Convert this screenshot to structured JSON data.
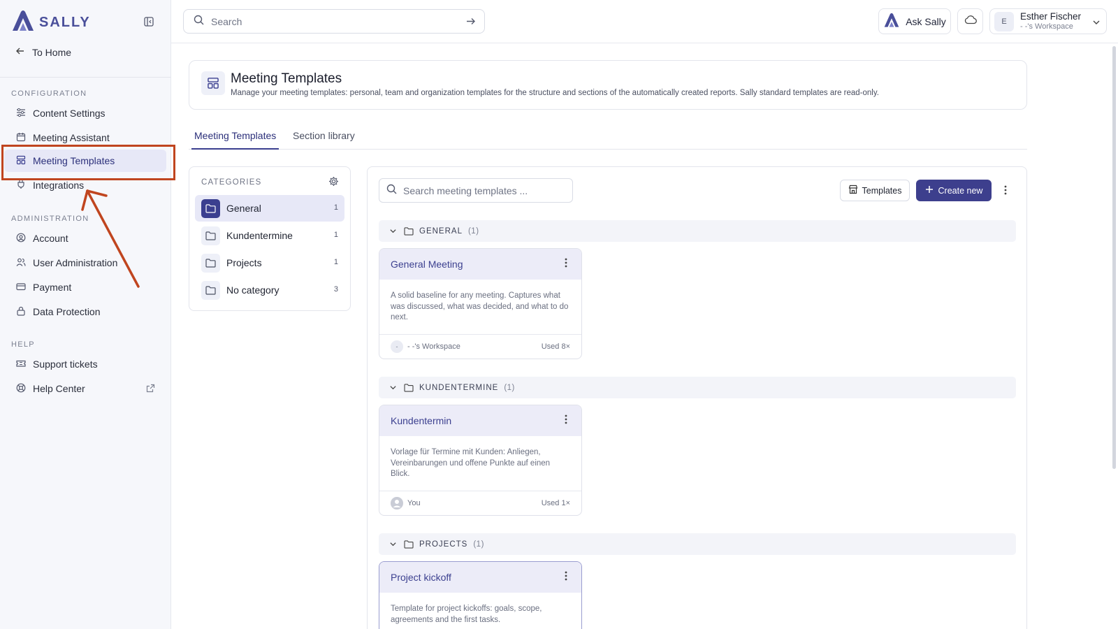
{
  "sidebar": {
    "brand": "SALLY",
    "to_home": "To Home",
    "sections": {
      "configuration": "CONFIGURATION",
      "administration": "ADMINISTRATION",
      "help": "HELP"
    },
    "items": {
      "content_settings": "Content Settings",
      "meeting_assistant": "Meeting Assistant",
      "meeting_templates": "Meeting Templates",
      "integrations": "Integrations",
      "account": "Account",
      "user_administration": "User Administration",
      "payment": "Payment",
      "data_protection": "Data Protection",
      "support_tickets": "Support tickets",
      "help_center": "Help Center"
    },
    "active_item": "meeting_templates"
  },
  "topbar": {
    "search_placeholder": "Search",
    "ask_label": "Ask Sally",
    "user": {
      "initial": "E",
      "name": "Esther Fischer",
      "workspace": "- -'s Workspace"
    }
  },
  "header": {
    "title": "Meeting Templates",
    "description": "Manage your meeting templates: personal, team and organization templates for the structure and sections of the automatically created reports. Sally standard templates are read-only."
  },
  "tabs": [
    "Meeting Templates",
    "Section library"
  ],
  "active_tab": 0,
  "categories": {
    "title": "CATEGORIES",
    "items": [
      {
        "label": "General",
        "count": "1"
      },
      {
        "label": "Kundentermine",
        "count": "1"
      },
      {
        "label": "Projects",
        "count": "1"
      },
      {
        "label": "No category",
        "count": "3"
      }
    ],
    "active_index": 0
  },
  "toolbar": {
    "search_placeholder": "Search meeting templates ...",
    "templates_label": "Templates",
    "create_label": "Create new"
  },
  "groups": [
    {
      "name": "GENERAL",
      "count": "(1)",
      "card": {
        "title": "General Meeting",
        "description": "A solid baseline for any meeting. Captures what was discussed, what was decided, and what to do next.",
        "owner_initial": "-",
        "owner": "- -'s Workspace",
        "used": "Used 8×"
      }
    },
    {
      "name": "KUNDENTERMINE",
      "count": "(1)",
      "card": {
        "title": "Kundentermin",
        "description": "Vorlage für Termine mit Kunden: Anliegen, Vereinbarungen und offene Punkte auf einen Blick.",
        "owner_initial": "",
        "owner": "You",
        "used": "Used 1×"
      }
    },
    {
      "name": "PROJECTS",
      "count": "(1)",
      "card": {
        "title": "Project kickoff",
        "description": "Template for project kickoffs: goals, scope, agreements and the first tasks."
      }
    }
  ],
  "colors": {
    "accent": "#3d3f8d",
    "active_bg": "#e7e8f7",
    "annotation": "#c0451f"
  }
}
